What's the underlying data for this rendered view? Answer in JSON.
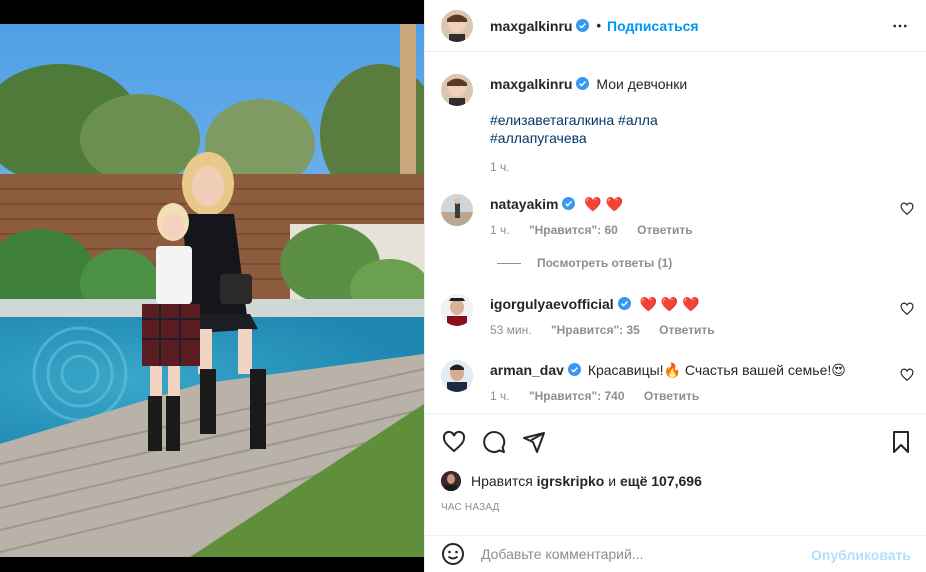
{
  "post": {
    "author": "maxgalkinru",
    "follow_label": "Подписаться",
    "dot": "•",
    "caption_author": "maxgalkinru",
    "caption_text": "Мои девчонки",
    "hashtags_line1": "#елизаветагалкина #алла",
    "hashtags_line2": "#аллапугачева",
    "caption_time": "1 ч."
  },
  "comments": [
    {
      "user": "natayakim",
      "text": "❤️ ❤️",
      "time": "1 ч.",
      "likes": "\"Нравится\": 60",
      "reply": "Ответить"
    },
    {
      "user": "igorgulyaevofficial",
      "text": "❤️ ❤️ ❤️",
      "time": "53 мин.",
      "likes": "\"Нравится\": 35",
      "reply": "Ответить"
    },
    {
      "user": "arman_dav",
      "text": "Красавицы!🔥 Счастья вашей семье!😍",
      "time": "1 ч.",
      "likes": "\"Нравится\": 740",
      "reply": "Ответить"
    }
  ],
  "view_replies": "Посмотреть ответы (1)",
  "likes_summary": {
    "prefix": "Нравится",
    "user": "igrskripko",
    "middle": "и",
    "rest": "ещё 107,696"
  },
  "time_ago": "ЧАС НАЗАД",
  "composer": {
    "placeholder": "Добавьте комментарий...",
    "publish_label": "Опубликовать"
  },
  "icons": {
    "verified": "verified-badge-icon",
    "more": "more-options-icon",
    "like": "heart-icon",
    "comment": "comment-icon",
    "share": "share-icon",
    "save": "bookmark-icon",
    "emoji": "emoji-icon"
  },
  "colors": {
    "accent": "#0095f6",
    "link": "#00376b",
    "muted": "#8e8e8e",
    "verified": "#3897f0",
    "publish_disabled": "#b2dffc"
  }
}
